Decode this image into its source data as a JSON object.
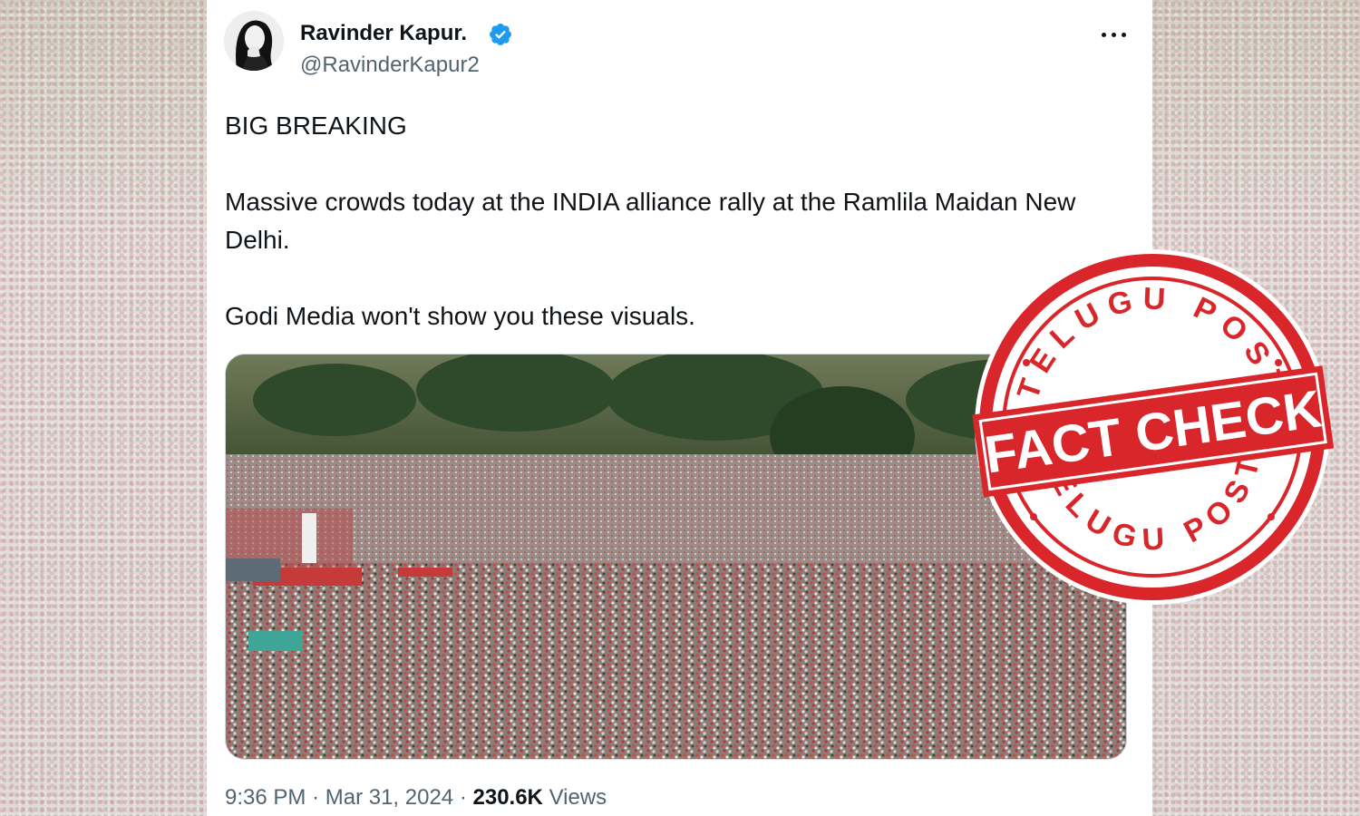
{
  "tweet": {
    "author_name": "Ravinder Kapur.",
    "author_handle": "@RavinderKapur2",
    "text": {
      "line1": "BIG BREAKING",
      "line2": "Massive crowds today at the INDIA alliance rally at the Ramlila Maidan New Delhi.",
      "line3": "Godi Media won't show you these visuals."
    },
    "time": "9:36 PM",
    "separator": "·",
    "date": "Mar 31, 2024",
    "views_count": "230.6K",
    "views_label": "Views"
  },
  "icons": {
    "verified": "verified-badge-icon",
    "more": "more-options-icon"
  },
  "stamp": {
    "top_text": "TELUGU POST",
    "center_text": "FACT CHECK",
    "bottom_text": "TELUGU POST",
    "color": "#d8262b"
  },
  "colors": {
    "verified": "#1d9bf0",
    "text": "#0f1419",
    "secondary": "#536471"
  }
}
